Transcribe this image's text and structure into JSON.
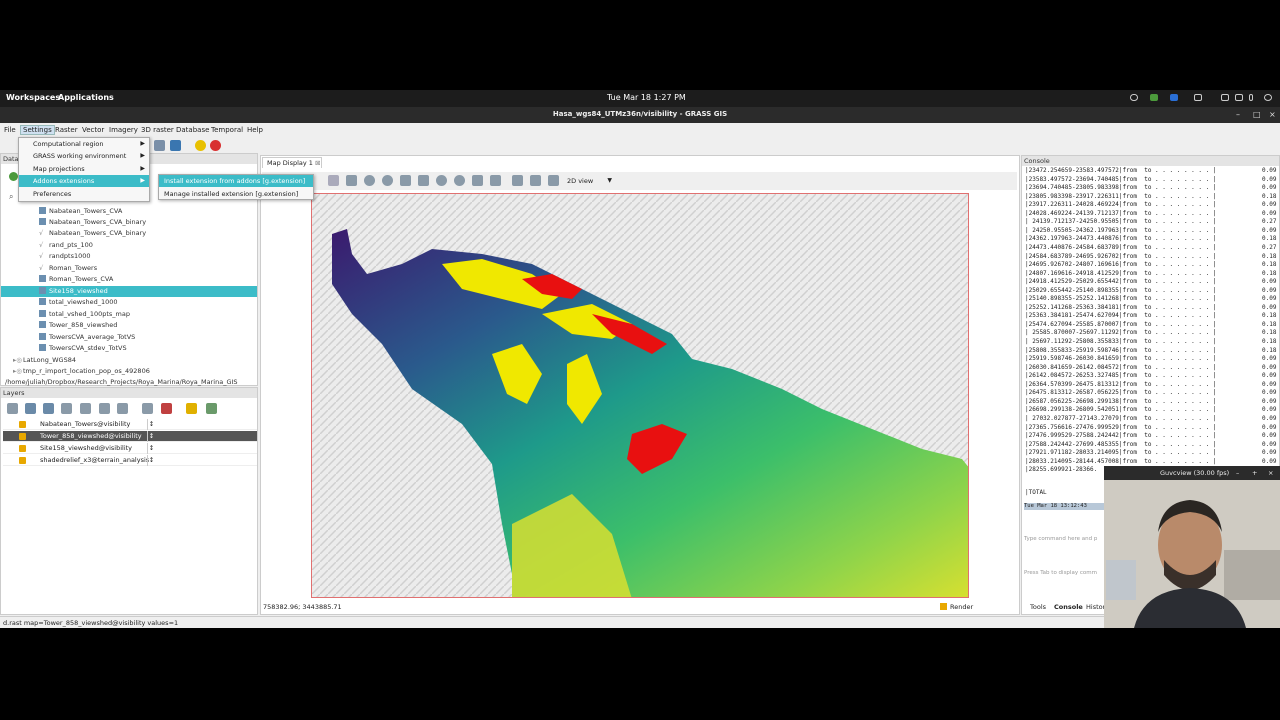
{
  "topbar": {
    "workspaces": "Workspaces",
    "applications": "Applications",
    "datetime": "Tue Mar 18  1:27 PM"
  },
  "window": {
    "title": "Hasa_wgs84_UTMz36n/visibility - GRASS GIS"
  },
  "menubar": [
    "File",
    "Settings",
    "Raster",
    "Vector",
    "Imagery",
    "3D raster",
    "Database",
    "Temporal",
    "Help"
  ],
  "settings_menu": [
    "Computational region",
    "GRASS working environment",
    "Map projections",
    "Addons extensions",
    "Preferences"
  ],
  "addons_submenu": [
    {
      "label": "Install extension from addons",
      "cmd": "[g.extension]"
    },
    {
      "label": "Manage installed extension",
      "cmd": "[g.extension]"
    }
  ],
  "data_panel": {
    "header": "Data",
    "items": [
      "Nabatean_Towers_CVA",
      "Nabatean_Towers_CVA_binary",
      "Nabatean_Towers_CVA_binary",
      "rand_pts_100",
      "randpts1000",
      "Roman_Towers",
      "Roman_Towers_CVA",
      "Site158_viewshed",
      "total_viewshed_1000",
      "total_vshed_100pts_map",
      "Tower_858_viewshed",
      "TowersCVA_average_TotVS",
      "TowersCVA_stdev_TotVS"
    ],
    "location": "LatLong_WGS84",
    "location2": "tmp_r_import_location_pop_os_492806",
    "path": "/home/juliah/Dropbox/Research_Projects/Roya_Marina/Roya_Marina_GIS"
  },
  "layers_panel": {
    "header": "Layers",
    "rows": [
      "Nabatean_Towers@visibility",
      "Tower_858_viewshed@visibility",
      "Site158_viewshed@visibility",
      "shadedrelief_x3@terrain_analysis"
    ]
  },
  "map": {
    "tab": "Map Display 1",
    "view": "2D view",
    "coords": "758382.96; 3443885.71",
    "render": "Render"
  },
  "console": {
    "header": "Console",
    "lines": [
      "|23472.254659-23583.497572|from  to . . . . . . . . |",
      "|23583.497572-23694.740485|from  to . . . . . . . . |",
      "|23694.740485-23805.983398|from  to . . . . . . . . |",
      "|23805.983398-23917.226311|from  to . . . . . . . . |",
      "|23917.226311-24028.469224|from  to . . . . . . . . |",
      "|24028.469224-24139.712137|from  to . . . . . . . . |",
      "| 24139.712137-24250.95505|from  to . . . . . . . . |",
      "| 24250.95505-24362.197963|from  to . . . . . . . . |",
      "|24362.197963-24473.440876|from  to . . . . . . . . |",
      "|24473.440876-24584.683789|from  to . . . . . . . . |",
      "|24584.683789-24695.926702|from  to . . . . . . . . |",
      "|24695.926702-24807.169616|from  to . . . . . . . . |",
      "|24807.169616-24918.412529|from  to . . . . . . . . |",
      "|24918.412529-25029.655442|from  to . . . . . . . . |",
      "|25029.655442-25140.898355|from  to . . . . . . . . |",
      "|25140.898355-25252.141268|from  to . . . . . . . . |",
      "|25252.141268-25363.384181|from  to . . . . . . . . |",
      "|25363.384181-25474.627094|from  to . . . . . . . . |",
      "|25474.627094-25585.870007|from  to . . . . . . . . |",
      "| 25585.870007-25697.11292|from  to . . . . . . . . |",
      "| 25697.11292-25808.355833|from  to . . . . . . . . |",
      "|25808.355833-25919.598746|from  to . . . . . . . . |",
      "|25919.598746-26030.841659|from  to . . . . . . . . |",
      "|26030.841659-26142.084572|from  to . . . . . . . . |",
      "|26142.084572-26253.327485|from  to . . . . . . . . |",
      "|26364.570399-26475.813312|from  to . . . . . . . . |",
      "|26475.813312-26587.056225|from  to . . . . . . . . |",
      "|26587.056225-26698.299138|from  to . . . . . . . . |",
      "|26698.299138-26809.542051|from  to . . . . . . . . |",
      "| 27032.027877-27143.27079|from  to . . . . . . . . |",
      "|27365.756616-27476.999529|from  to . . . . . . . . |",
      "|27476.999529-27588.242442|from  to . . . . . . . . |",
      "|27588.242442-27699.485355|from  to . . . . . . . . |",
      "|27921.971182-28033.214095|from  to . . . . . . . . |",
      "|28033.214095-28144.457008|from  to . . . . . . . . |",
      "|28255.699921-28366."
    ],
    "values": [
      "0.09",
      "0.09",
      "0.09",
      "0.18",
      "0.09",
      "0.09",
      "0.27",
      "0.09",
      "0.18",
      "0.27",
      "0.18",
      "0.18",
      "0.18",
      "0.09",
      "0.09",
      "0.09",
      "0.09",
      "0.18",
      "0.18",
      "0.18",
      "0.18",
      "0.18",
      "0.09",
      "0.09",
      "0.09",
      "0.09",
      "0.09",
      "0.09",
      "0.09",
      "0.09",
      "0.09",
      "0.09",
      "0.09",
      "0.09",
      "0.09"
    ],
    "total": "|TOTAL",
    "timestamp": "Tue Mar 18 13:12:43",
    "placeholder": "Type command here and p",
    "hint": "Press Tab to display comm",
    "tabs": [
      "Tools",
      "Console",
      "Histor"
    ]
  },
  "webcam": {
    "title": "Guvcview (30.00 fps)"
  },
  "statusbar": "d.rast map=Tower_858_viewshed@visibility values=1"
}
